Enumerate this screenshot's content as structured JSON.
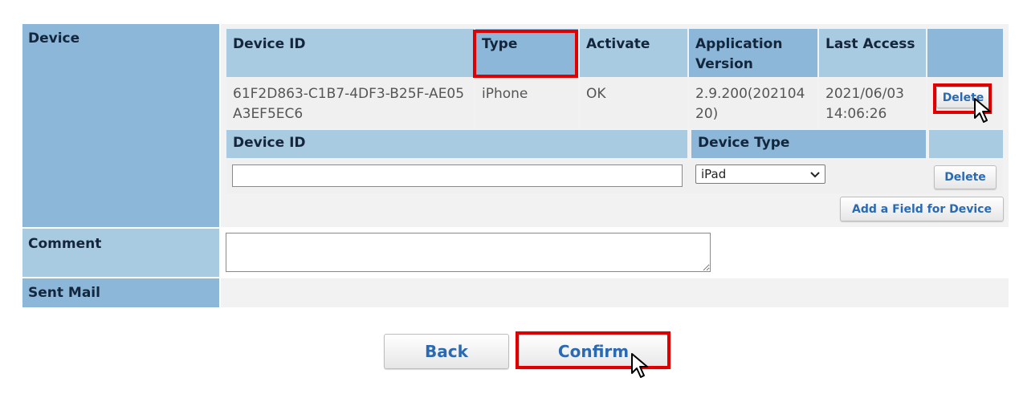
{
  "labels": {
    "device": "Device",
    "comment": "Comment",
    "sent_mail": "Sent Mail"
  },
  "device_table": {
    "headers": {
      "device_id": "Device ID",
      "type": "Type",
      "activate": "Activate",
      "application_version": "Application Version",
      "last_access": "Last Access"
    },
    "row": {
      "device_id": "61F2D863-C1B7-4DF3-B25F-AE05A3EF5EC6",
      "type": "iPhone",
      "activate": "OK",
      "application_version": "2.9.200(20210420)",
      "last_access": "2021/06/03 14:06:26",
      "delete_label": "Delete"
    }
  },
  "new_device": {
    "headers": {
      "device_id": "Device ID",
      "device_type": "Device Type"
    },
    "device_id_value": "",
    "device_type_selected": "iPad",
    "delete_label": "Delete",
    "add_field_label": "Add a Field for Device"
  },
  "comment_value": "",
  "buttons": {
    "back": "Back",
    "confirm": "Confirm"
  },
  "colors": {
    "label_dark": "#8cb7d8",
    "label_light": "#a9cbe2",
    "button_text": "#2a6ab3",
    "highlight": "#e00000"
  }
}
